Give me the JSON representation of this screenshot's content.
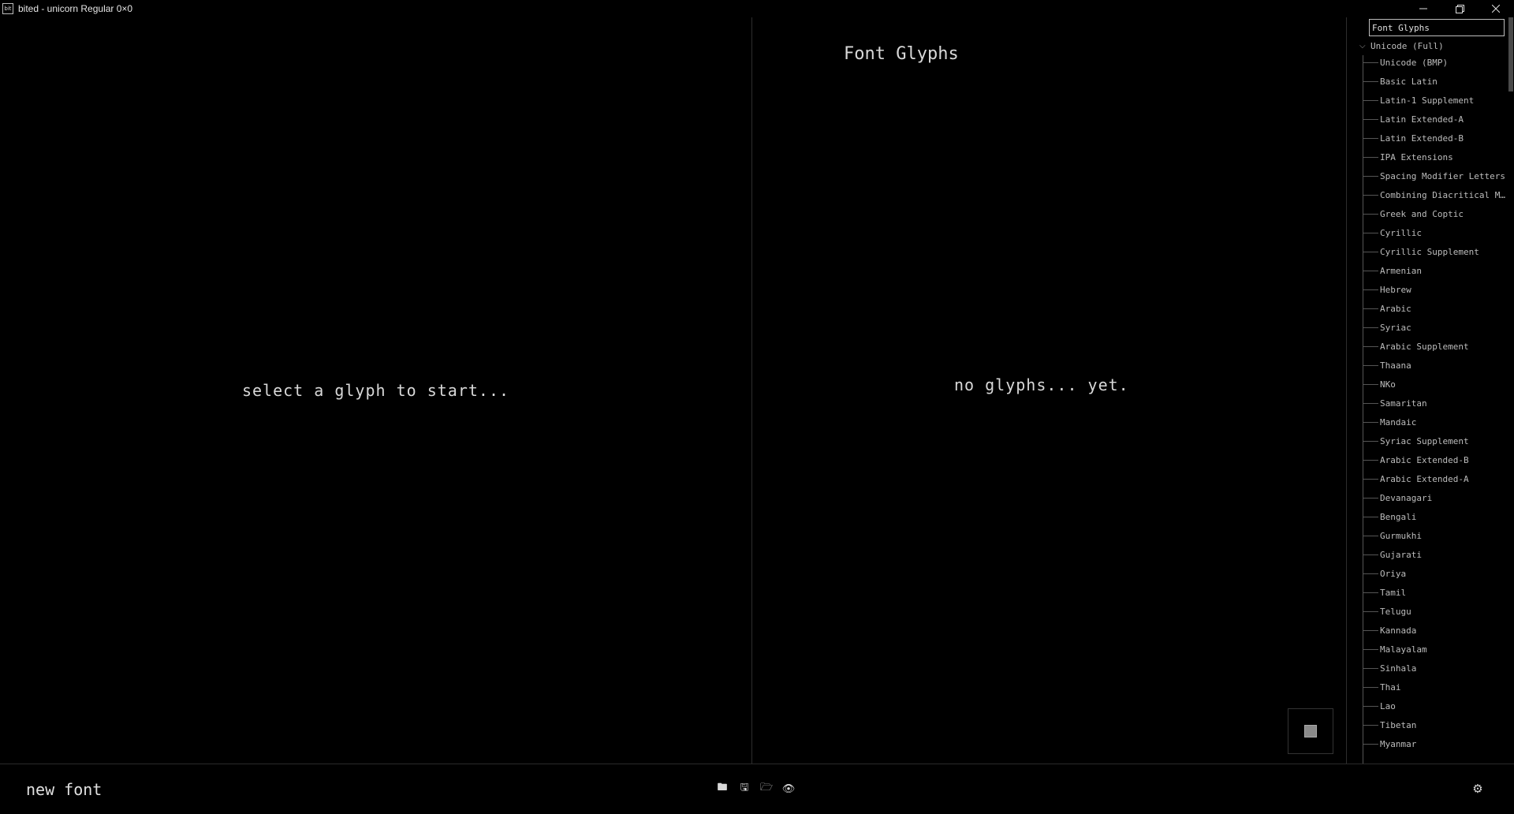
{
  "window": {
    "app_icon_text": "bit",
    "title": "bited - unicorn Regular 0×0",
    "minimize_icon": "minimize-icon",
    "restore_icon": "restore-icon",
    "close_icon": "close-icon"
  },
  "editor": {
    "placeholder": "select a glyph to start..."
  },
  "glyphs": {
    "title": "Font Glyphs",
    "empty_message": "no glyphs... yet."
  },
  "sidebar": {
    "search_value": "Font Glyphs",
    "root_label": "Unicode (Full)",
    "items": [
      "Unicode (BMP)",
      "Basic Latin",
      "Latin-1 Supplement",
      "Latin Extended-A",
      "Latin Extended-B",
      "IPA Extensions",
      "Spacing Modifier Letters",
      "Combining Diacritical Ma...",
      "Greek and Coptic",
      "Cyrillic",
      "Cyrillic Supplement",
      "Armenian",
      "Hebrew",
      "Arabic",
      "Syriac",
      "Arabic Supplement",
      "Thaana",
      "NKo",
      "Samaritan",
      "Mandaic",
      "Syriac Supplement",
      "Arabic Extended-B",
      "Arabic Extended-A",
      "Devanagari",
      "Bengali",
      "Gurmukhi",
      "Gujarati",
      "Oriya",
      "Tamil",
      "Telugu",
      "Kannada",
      "Malayalam",
      "Sinhala",
      "Thai",
      "Lao",
      "Tibetan",
      "Myanmar"
    ]
  },
  "bottombar": {
    "font_name": "new font",
    "tools": [
      {
        "icon": "new-font-icon",
        "glyph": "🖿"
      },
      {
        "icon": "save-icon",
        "glyph": "🖫"
      },
      {
        "icon": "open-folder-icon",
        "glyph": "🗁"
      },
      {
        "icon": "preview-eye-icon",
        "glyph": "👁"
      }
    ],
    "settings_icon": "gear-icon"
  },
  "colors": {
    "background": "#000000",
    "text": "#cfcfcf",
    "divider": "#2e2e2e"
  }
}
